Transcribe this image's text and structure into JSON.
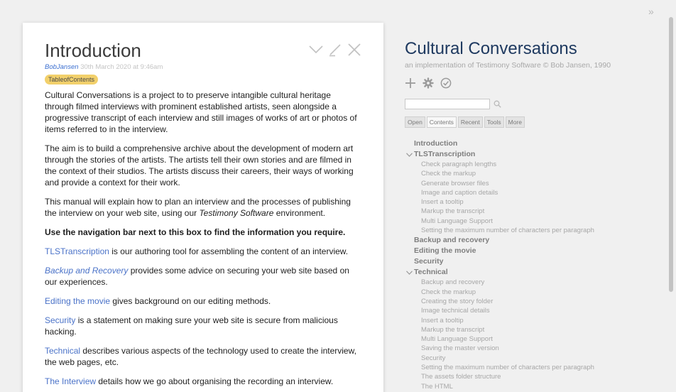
{
  "main": {
    "title": "Introduction",
    "author": "BobJansen",
    "date": "30th March 2020 at 9:46am",
    "tag": "TableofContents",
    "p1": "Cultural Conversations is a project to to preserve intangible cultural heritage through filmed interviews with prominent established artists, seen alongside a progressive transcript of each interview and still images of works of art or photos of items referred to in the interview.",
    "p2": "The aim is to build a comprehensive archive about the development of modern art through the stories of the artists. The artists tell their own stories and are filmed in the context of their studios. The artists discuss their careers, their ways of working and provide a context for their work.",
    "p3_before": "This manual will explain how to plan an interview and the processes of publishing the interview on your web site, using our ",
    "p3_em": "Testimony Software",
    "p3_after": " environment.",
    "p4": "Use the navigation bar next to this box to find the information you require.",
    "links": [
      {
        "link": "TLSTranscription",
        "text": " is our authoring tool for assembling the content of an interview."
      },
      {
        "link": "Backup and Recovery",
        "text": " provides some advice on securing your web site based on our experiences."
      },
      {
        "link": "Editing the movie",
        "text": " gives background on our editing methods."
      },
      {
        "link": "Security",
        "text": " is a statement on making sure your web site is secure from malicious hacking."
      },
      {
        "link": "Technical",
        "text": " describes various aspects of the technology used to create the interview, the web pages, etc."
      },
      {
        "link": "The Interview",
        "text": " details how we go about organising the recording an interview."
      }
    ]
  },
  "sidebar": {
    "title": "Cultural Conversations",
    "subtitle": "an implementation of Testimony Software © Bob Jansen, 1990",
    "search_placeholder": "",
    "tabs": [
      "Open",
      "Contents",
      "Recent",
      "Tools",
      "More"
    ],
    "toc": {
      "introduction": "Introduction",
      "tls": {
        "label": "TLSTranscription",
        "children": [
          "Check paragraph lengths",
          "Check the markup",
          "Generate browser files",
          "Image and caption details",
          "Insert a tooltip",
          "Markup the transcript",
          "Multi Language Support",
          "Setting the maximum number of characters per paragraph"
        ]
      },
      "backup": "Backup and recovery",
      "editing": "Editing the movie",
      "security": "Security",
      "technical": {
        "label": "Technical",
        "children": [
          "Backup and recovery",
          "Check the markup",
          "Creating the story folder",
          "Image technical details",
          "Insert a tooltip",
          "Markup the transcript",
          "Multi Language Support",
          "Saving the master version",
          "Security",
          "Setting the maximum number of characters per paragraph",
          "The assets folder structure",
          "The HTML"
        ]
      }
    }
  },
  "colors": {
    "accent": "#4a72c8",
    "tag_bg": "#f2d06b",
    "sidebar_title": "#1f3a60"
  },
  "scroll": {
    "thumb_fraction": 0.73
  }
}
